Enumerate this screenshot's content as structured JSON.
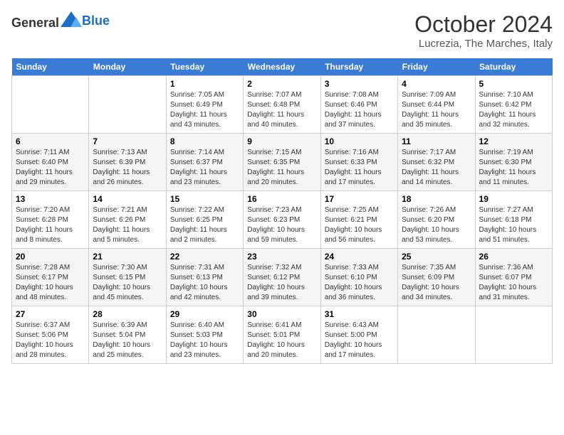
{
  "header": {
    "logo_general": "General",
    "logo_blue": "Blue",
    "month": "October 2024",
    "location": "Lucrezia, The Marches, Italy"
  },
  "days_of_week": [
    "Sunday",
    "Monday",
    "Tuesday",
    "Wednesday",
    "Thursday",
    "Friday",
    "Saturday"
  ],
  "weeks": [
    [
      {
        "day": "",
        "sunrise": "",
        "sunset": "",
        "daylight": ""
      },
      {
        "day": "",
        "sunrise": "",
        "sunset": "",
        "daylight": ""
      },
      {
        "day": "1",
        "sunrise": "Sunrise: 7:05 AM",
        "sunset": "Sunset: 6:49 PM",
        "daylight": "Daylight: 11 hours and 43 minutes."
      },
      {
        "day": "2",
        "sunrise": "Sunrise: 7:07 AM",
        "sunset": "Sunset: 6:48 PM",
        "daylight": "Daylight: 11 hours and 40 minutes."
      },
      {
        "day": "3",
        "sunrise": "Sunrise: 7:08 AM",
        "sunset": "Sunset: 6:46 PM",
        "daylight": "Daylight: 11 hours and 37 minutes."
      },
      {
        "day": "4",
        "sunrise": "Sunrise: 7:09 AM",
        "sunset": "Sunset: 6:44 PM",
        "daylight": "Daylight: 11 hours and 35 minutes."
      },
      {
        "day": "5",
        "sunrise": "Sunrise: 7:10 AM",
        "sunset": "Sunset: 6:42 PM",
        "daylight": "Daylight: 11 hours and 32 minutes."
      }
    ],
    [
      {
        "day": "6",
        "sunrise": "Sunrise: 7:11 AM",
        "sunset": "Sunset: 6:40 PM",
        "daylight": "Daylight: 11 hours and 29 minutes."
      },
      {
        "day": "7",
        "sunrise": "Sunrise: 7:13 AM",
        "sunset": "Sunset: 6:39 PM",
        "daylight": "Daylight: 11 hours and 26 minutes."
      },
      {
        "day": "8",
        "sunrise": "Sunrise: 7:14 AM",
        "sunset": "Sunset: 6:37 PM",
        "daylight": "Daylight: 11 hours and 23 minutes."
      },
      {
        "day": "9",
        "sunrise": "Sunrise: 7:15 AM",
        "sunset": "Sunset: 6:35 PM",
        "daylight": "Daylight: 11 hours and 20 minutes."
      },
      {
        "day": "10",
        "sunrise": "Sunrise: 7:16 AM",
        "sunset": "Sunset: 6:33 PM",
        "daylight": "Daylight: 11 hours and 17 minutes."
      },
      {
        "day": "11",
        "sunrise": "Sunrise: 7:17 AM",
        "sunset": "Sunset: 6:32 PM",
        "daylight": "Daylight: 11 hours and 14 minutes."
      },
      {
        "day": "12",
        "sunrise": "Sunrise: 7:19 AM",
        "sunset": "Sunset: 6:30 PM",
        "daylight": "Daylight: 11 hours and 11 minutes."
      }
    ],
    [
      {
        "day": "13",
        "sunrise": "Sunrise: 7:20 AM",
        "sunset": "Sunset: 6:28 PM",
        "daylight": "Daylight: 11 hours and 8 minutes."
      },
      {
        "day": "14",
        "sunrise": "Sunrise: 7:21 AM",
        "sunset": "Sunset: 6:26 PM",
        "daylight": "Daylight: 11 hours and 5 minutes."
      },
      {
        "day": "15",
        "sunrise": "Sunrise: 7:22 AM",
        "sunset": "Sunset: 6:25 PM",
        "daylight": "Daylight: 11 hours and 2 minutes."
      },
      {
        "day": "16",
        "sunrise": "Sunrise: 7:23 AM",
        "sunset": "Sunset: 6:23 PM",
        "daylight": "Daylight: 10 hours and 59 minutes."
      },
      {
        "day": "17",
        "sunrise": "Sunrise: 7:25 AM",
        "sunset": "Sunset: 6:21 PM",
        "daylight": "Daylight: 10 hours and 56 minutes."
      },
      {
        "day": "18",
        "sunrise": "Sunrise: 7:26 AM",
        "sunset": "Sunset: 6:20 PM",
        "daylight": "Daylight: 10 hours and 53 minutes."
      },
      {
        "day": "19",
        "sunrise": "Sunrise: 7:27 AM",
        "sunset": "Sunset: 6:18 PM",
        "daylight": "Daylight: 10 hours and 51 minutes."
      }
    ],
    [
      {
        "day": "20",
        "sunrise": "Sunrise: 7:28 AM",
        "sunset": "Sunset: 6:17 PM",
        "daylight": "Daylight: 10 hours and 48 minutes."
      },
      {
        "day": "21",
        "sunrise": "Sunrise: 7:30 AM",
        "sunset": "Sunset: 6:15 PM",
        "daylight": "Daylight: 10 hours and 45 minutes."
      },
      {
        "day": "22",
        "sunrise": "Sunrise: 7:31 AM",
        "sunset": "Sunset: 6:13 PM",
        "daylight": "Daylight: 10 hours and 42 minutes."
      },
      {
        "day": "23",
        "sunrise": "Sunrise: 7:32 AM",
        "sunset": "Sunset: 6:12 PM",
        "daylight": "Daylight: 10 hours and 39 minutes."
      },
      {
        "day": "24",
        "sunrise": "Sunrise: 7:33 AM",
        "sunset": "Sunset: 6:10 PM",
        "daylight": "Daylight: 10 hours and 36 minutes."
      },
      {
        "day": "25",
        "sunrise": "Sunrise: 7:35 AM",
        "sunset": "Sunset: 6:09 PM",
        "daylight": "Daylight: 10 hours and 34 minutes."
      },
      {
        "day": "26",
        "sunrise": "Sunrise: 7:36 AM",
        "sunset": "Sunset: 6:07 PM",
        "daylight": "Daylight: 10 hours and 31 minutes."
      }
    ],
    [
      {
        "day": "27",
        "sunrise": "Sunrise: 6:37 AM",
        "sunset": "Sunset: 5:06 PM",
        "daylight": "Daylight: 10 hours and 28 minutes."
      },
      {
        "day": "28",
        "sunrise": "Sunrise: 6:39 AM",
        "sunset": "Sunset: 5:04 PM",
        "daylight": "Daylight: 10 hours and 25 minutes."
      },
      {
        "day": "29",
        "sunrise": "Sunrise: 6:40 AM",
        "sunset": "Sunset: 5:03 PM",
        "daylight": "Daylight: 10 hours and 23 minutes."
      },
      {
        "day": "30",
        "sunrise": "Sunrise: 6:41 AM",
        "sunset": "Sunset: 5:01 PM",
        "daylight": "Daylight: 10 hours and 20 minutes."
      },
      {
        "day": "31",
        "sunrise": "Sunrise: 6:43 AM",
        "sunset": "Sunset: 5:00 PM",
        "daylight": "Daylight: 10 hours and 17 minutes."
      },
      {
        "day": "",
        "sunrise": "",
        "sunset": "",
        "daylight": ""
      },
      {
        "day": "",
        "sunrise": "",
        "sunset": "",
        "daylight": ""
      }
    ]
  ]
}
